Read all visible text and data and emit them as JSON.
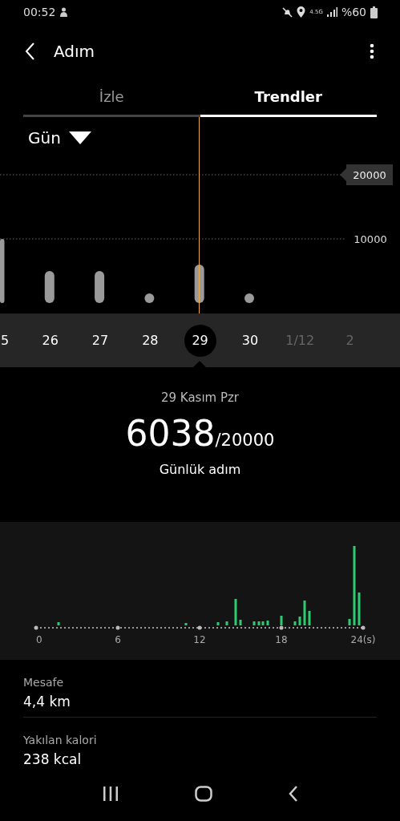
{
  "status_bar": {
    "time": "00:52",
    "network": "4.5G",
    "battery": "%60"
  },
  "header": {
    "title": "Adım"
  },
  "tabs": [
    {
      "label": "İzle",
      "selected": false
    },
    {
      "label": "Trendler",
      "selected": true
    }
  ],
  "period": {
    "label": "Gün"
  },
  "daily_chart": {
    "chart_data": {
      "type": "bar",
      "categories": [
        "5",
        "26",
        "27",
        "28",
        "29",
        "30",
        "1/12",
        "2"
      ],
      "values": [
        10000,
        5000,
        5000,
        1500,
        6000,
        1500,
        null,
        null
      ],
      "ylim": [
        0,
        20000
      ],
      "yticks": [
        {
          "value": 10000,
          "label": "10000"
        },
        {
          "value": 20000,
          "label": "20000"
        }
      ]
    }
  },
  "dates": [
    {
      "selected": false,
      "disabled": false
    },
    {
      "selected": false,
      "disabled": false
    },
    {
      "selected": false,
      "disabled": false
    },
    {
      "selected": false,
      "disabled": false
    },
    {
      "selected": true,
      "disabled": false
    },
    {
      "selected": false,
      "disabled": false
    },
    {
      "selected": false,
      "disabled": true
    },
    {
      "selected": false,
      "disabled": true
    }
  ],
  "summary": {
    "date": "29 Kasım Pzr",
    "steps": "6038",
    "goal": "/20000",
    "caption": "Günlük adım"
  },
  "hourly_chart": {
    "x_labels": [
      "0",
      "6",
      "12",
      "18",
      "24(s)"
    ]
  },
  "stats": [
    {
      "label": "Mesafe",
      "value": "4,4 km"
    },
    {
      "label": "Yakılan kalori",
      "value": "238 kcal"
    }
  ]
}
